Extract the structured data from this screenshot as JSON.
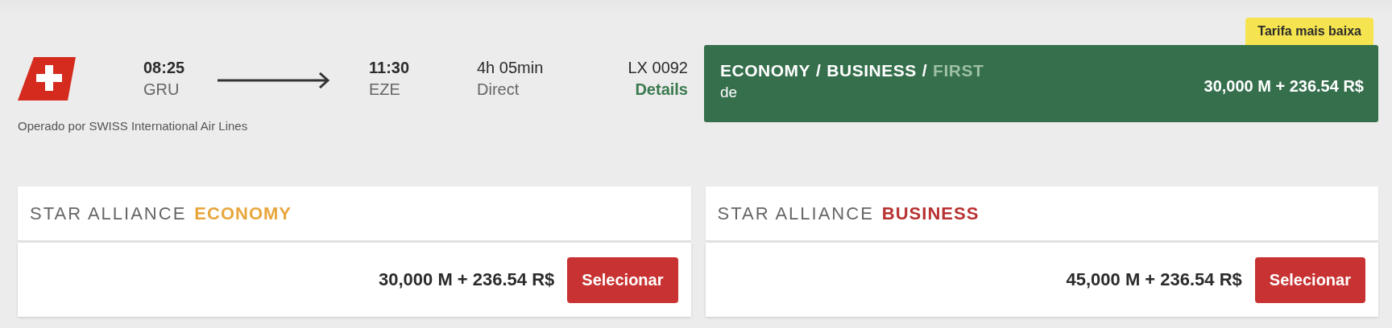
{
  "flight": {
    "departure": {
      "time": "08:25",
      "airport": "GRU"
    },
    "arrival": {
      "time": "11:30",
      "airport": "EZE"
    },
    "duration": "4h 05min",
    "stops": "Direct",
    "flight_number": "LX 0092",
    "details_link": "Details",
    "operator": "Operado por SWISS International Air Lines"
  },
  "fare_banner": {
    "badge": "Tarifa mais baixa",
    "cabins": [
      {
        "label": "ECONOMY",
        "available": true
      },
      {
        "label": "BUSINESS",
        "available": true
      },
      {
        "label": "FIRST",
        "available": false
      }
    ],
    "separator": "/",
    "prefix": "de",
    "price": "30,000 M + 236.54 R$"
  },
  "fare_cards": [
    {
      "brand": "STAR ALLIANCE",
      "cabin": "ECONOMY",
      "color": "#e8a63c",
      "price": "30,000 M + 236.54 R$",
      "button": "Selecionar"
    },
    {
      "brand": "STAR ALLIANCE",
      "cabin": "BUSINESS",
      "color": "#b83232",
      "price": "45,000 M + 236.54 R$",
      "button": "Selecionar"
    }
  ]
}
